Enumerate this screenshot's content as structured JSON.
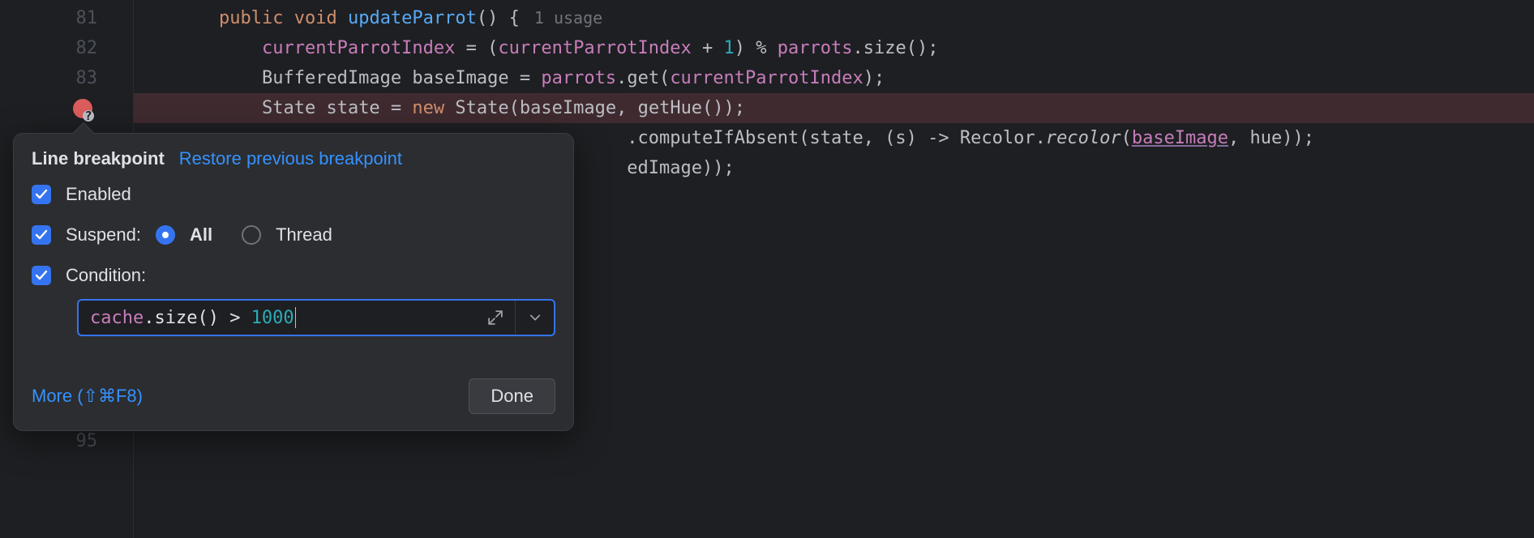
{
  "editor": {
    "lines": [
      {
        "num": "81"
      },
      {
        "num": "82"
      },
      {
        "num": "83"
      },
      {
        "num": ""
      },
      {
        "num": "95"
      }
    ],
    "line81": {
      "kw_public": "public",
      "kw_void": "void",
      "method": "updateParrot",
      "open": "() {",
      "lens": "1 usage"
    },
    "line82": {
      "field1": "currentParrotIndex",
      "eq": " = (",
      "field2": "currentParrotIndex",
      "plus": " + ",
      "one": "1",
      "close": ") % ",
      "field3": "parrots",
      "call": ".size();"
    },
    "line83": {
      "type": "BufferedImage ",
      "var": "baseImage = ",
      "field": "parrots",
      "get": ".get(",
      "arg": "currentParrotIndex",
      "end": ");"
    },
    "line84": {
      "type": "State ",
      "var": "state = ",
      "kw_new": "new",
      "ctor": " State(baseImage, getHue());"
    },
    "line85": {
      "tail_a": ".computeIfAbsent(state, (s) -> Recolor.",
      "recolor": "recolor",
      "open": "(",
      "base": "baseImage",
      "rest": ", hue));"
    },
    "line86": {
      "tail": "edImage));"
    }
  },
  "popup": {
    "title": "Line breakpoint",
    "restore": "Restore previous breakpoint",
    "enabled": "Enabled",
    "suspend": "Suspend:",
    "all": "All",
    "thread": "Thread",
    "condition_label": "Condition:",
    "condition_expr": {
      "obj": "cache",
      "call": ".size() > ",
      "num": "1000"
    },
    "more": "More (⇧⌘F8)",
    "done": "Done"
  }
}
